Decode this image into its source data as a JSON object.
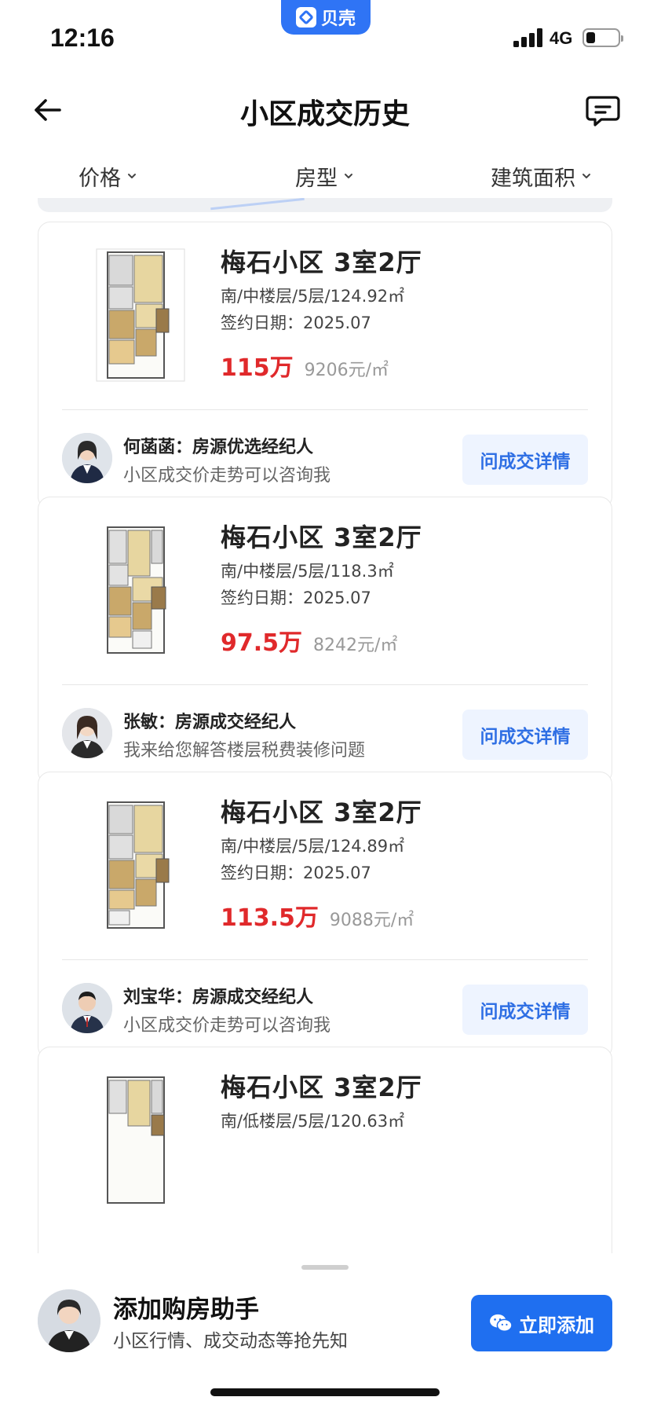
{
  "status_bar": {
    "time": "12:16",
    "app_badge": "贝壳",
    "network": "4G",
    "battery_level": 0.3
  },
  "nav": {
    "title": "小区成交历史",
    "back_icon": "back-arrow-icon",
    "message_icon": "message-icon"
  },
  "filters": [
    {
      "label": "价格"
    },
    {
      "label": "房型"
    },
    {
      "label": "建筑面积"
    }
  ],
  "listings": [
    {
      "title": "梅石小区 3室2厅",
      "meta": "南/中楼层/5层/124.92㎡",
      "date": "签约日期：2025.07",
      "price": "115万",
      "unit_price": "9206元/㎡",
      "agent_name": "何菡菡：房源优选经纪人",
      "agent_desc": "小区成交价走势可以咨询我",
      "button": "问成交详情"
    },
    {
      "title": "梅石小区 3室2厅",
      "meta": "南/中楼层/5层/118.3㎡",
      "date": "签约日期：2025.07",
      "price": "97.5万",
      "unit_price": "8242元/㎡",
      "agent_name": "张敏：房源成交经纪人",
      "agent_desc": "我来给您解答楼层税费装修问题",
      "button": "问成交详情"
    },
    {
      "title": "梅石小区 3室2厅",
      "meta": "南/中楼层/5层/124.89㎡",
      "date": "签约日期：2025.07",
      "price": "113.5万",
      "unit_price": "9088元/㎡",
      "agent_name": "刘宝华：房源成交经纪人",
      "agent_desc": "小区成交价走势可以咨询我",
      "button": "问成交详情"
    },
    {
      "title": "梅石小区 3室2厅",
      "meta": "南/低楼层/5层/120.63㎡"
    }
  ],
  "assistant": {
    "title": "添加购房助手",
    "subtitle": "小区行情、成交动态等抢先知",
    "button": "立即添加"
  },
  "colors": {
    "price_red": "#e0292b",
    "brand_blue": "#1f6ff0",
    "link_blue": "#2f6fe4"
  }
}
